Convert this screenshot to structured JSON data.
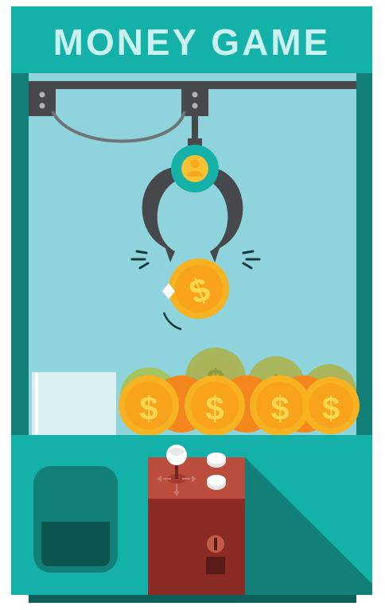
{
  "machine": {
    "title": "MONEY GAME",
    "claw_icon": "person-icon",
    "coin_icon": "dollar-sign",
    "joystick_icon": "joystick-icon"
  },
  "colors": {
    "frame": "#14b1a8",
    "frame_dark": "#128078",
    "glass": "#8fd4dc",
    "claw": "#46484b",
    "coin": "#f7b222",
    "coin_inner": "#f7a81f",
    "panel": "#ba4d3d",
    "cabinet": "#8a2b25"
  }
}
